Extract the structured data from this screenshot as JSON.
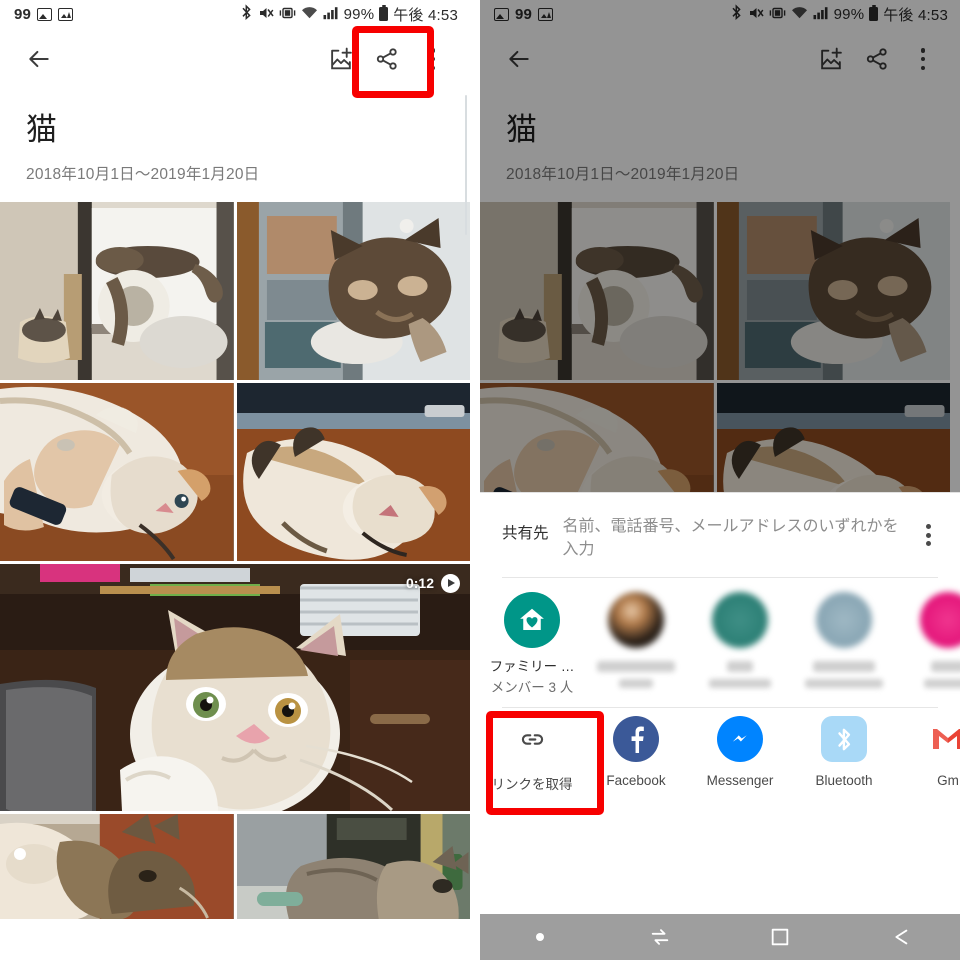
{
  "status_bar": {
    "notif_count": "99",
    "battery_pct": "99%",
    "time": "午後 4:53",
    "icons": [
      "photo-icon",
      "chart-icon",
      "bluetooth-icon",
      "mute-icon",
      "vibrate-icon",
      "wifi-icon",
      "signal-icon",
      "battery-icon"
    ]
  },
  "toolbar": {
    "back_label": "←",
    "add_photo_label": "写真を追加",
    "share_label": "共有",
    "overflow_label": "その他のオプション"
  },
  "album": {
    "title": "猫",
    "date_range": "2018年10月1日〜2019年1月20日"
  },
  "grid": {
    "video_badge": {
      "duration": "0:12",
      "play_label": "再生"
    },
    "photos": [
      {
        "alt": "cat-on-tower"
      },
      {
        "alt": "cat-by-window"
      },
      {
        "alt": "hand-petting-cat"
      },
      {
        "alt": "cat-on-back-table"
      },
      {
        "alt": "cat-video-thumbnail"
      },
      {
        "alt": "cat-sleeping-left"
      },
      {
        "alt": "cat-sleeping-right"
      }
    ]
  },
  "navbar": {
    "dot_label": "●",
    "switch_label": "切り替え",
    "recents_label": "最近のアプリ",
    "back_label": "戻る"
  },
  "share_sheet": {
    "recipient_label": "共有先",
    "recipient_placeholder": "名前、電話番号、メールアドレスのいずれかを入力",
    "overflow_label": "その他のオプション",
    "contacts": [
      {
        "name": "ファミリー …",
        "sub": "メンバー 3 人",
        "avatar": "family-home-heart-icon",
        "blurred": false
      },
      {
        "name": "",
        "sub": "",
        "avatar": "contact-photo",
        "blurred": true
      },
      {
        "name": "",
        "sub": "",
        "avatar": "contact-photo",
        "blurred": true
      },
      {
        "name": "",
        "sub": "",
        "avatar": "contact-photo",
        "blurred": true
      },
      {
        "name": "",
        "sub": "",
        "avatar": "contact-photo",
        "blurred": true
      }
    ],
    "apps": [
      {
        "label": "リンクを取得",
        "icon": "link-icon"
      },
      {
        "label": "Facebook",
        "icon": "facebook-icon"
      },
      {
        "label": "Messenger",
        "icon": "messenger-icon"
      },
      {
        "label": "Bluetooth",
        "icon": "bluetooth-icon"
      },
      {
        "label": "Gm",
        "icon": "gmail-icon"
      }
    ]
  },
  "annotations": {
    "share_button_highlight": "共有ボタン",
    "get_link_highlight": "リンクを取得"
  },
  "colors": {
    "highlight": "#f70000",
    "family_teal": "#009688",
    "facebook_blue": "#3b5998",
    "messenger_blue": "#0084ff",
    "bluetooth_blue": "#a9d9f7",
    "gmail_red": "#ea4335",
    "scrim": "rgba(0,0,0,0.42)"
  }
}
